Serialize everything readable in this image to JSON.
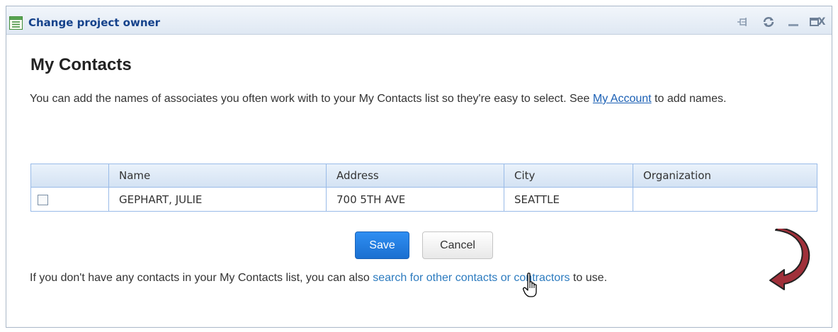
{
  "window": {
    "title": "Change project owner",
    "icons": {
      "app": "form-icon",
      "pin": "pin-icon",
      "refresh": "refresh-icon",
      "minimize": "minimize-icon",
      "maximize": "maximize-icon",
      "close": "close-icon"
    },
    "close_glyph": "X"
  },
  "page": {
    "heading": "My Contacts",
    "intro_text_before": "You can add the names of associates you often work with to your My Contacts list so they're easy to select. See ",
    "intro_link": "My Account",
    "intro_text_after": " to add names."
  },
  "table": {
    "columns": [
      "",
      "Name",
      "Address",
      "City",
      "Organization"
    ],
    "rows": [
      {
        "checked": false,
        "name": "GEPHART, JULIE",
        "address": "700 5TH AVE",
        "city": "SEATTLE",
        "organization": ""
      }
    ]
  },
  "actions": {
    "save_label": "Save",
    "cancel_label": "Cancel"
  },
  "footer": {
    "text_before": "If you don't have any contacts in your My Contacts list, you can also ",
    "link": "search for other contacts or contractors",
    "text_after": " to use."
  },
  "colors": {
    "title_text": "#15428b",
    "save_button": "#1a6fd0",
    "link": "#2c7bbf",
    "annotation_arrow": "#a0303a"
  }
}
